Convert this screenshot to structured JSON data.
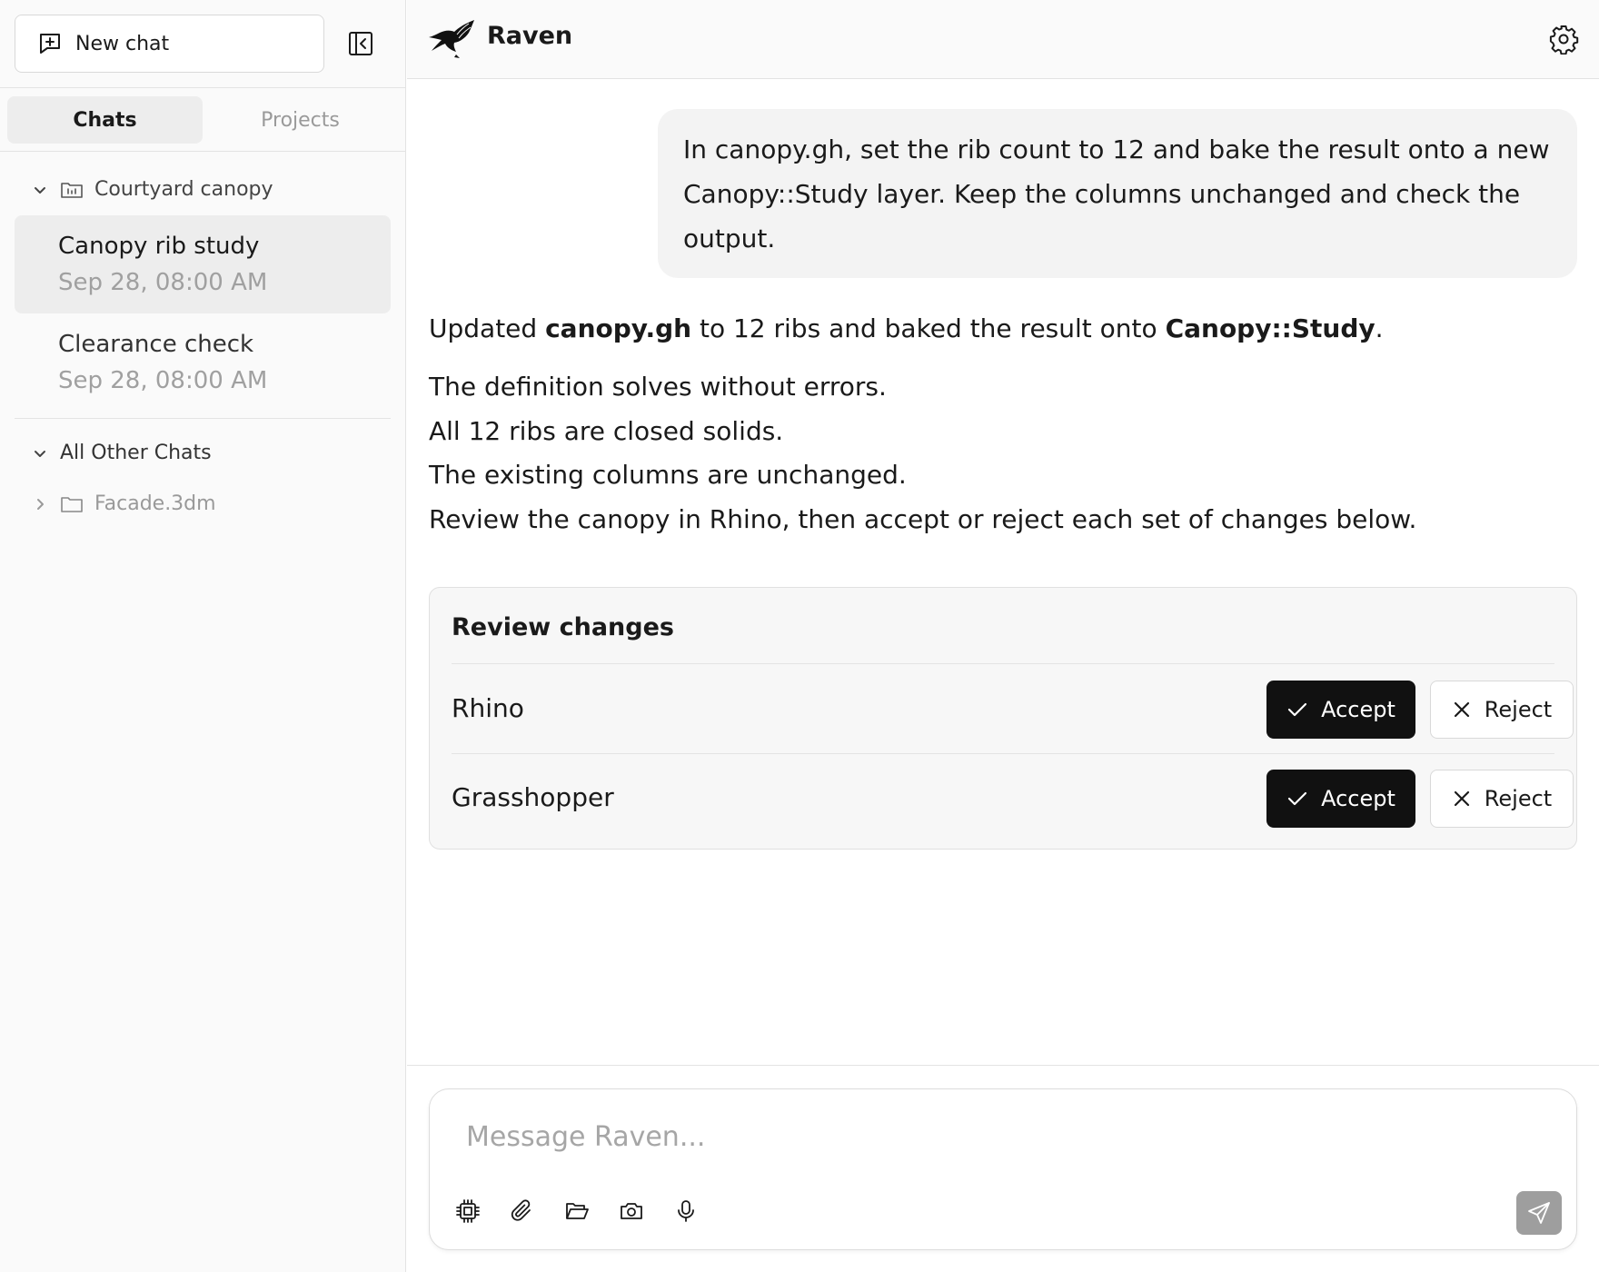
{
  "sidebar": {
    "new_chat_label": "New chat",
    "tabs": [
      {
        "label": "Chats",
        "active": true
      },
      {
        "label": "Projects",
        "active": false
      }
    ],
    "project_group": {
      "name": "Courtyard canopy",
      "chats": [
        {
          "title": "Canopy rib study",
          "date": "Sep 28, 08:00 AM",
          "active": true
        },
        {
          "title": "Clearance check",
          "date": "Sep 28, 08:00 AM",
          "active": false
        }
      ]
    },
    "other_chats_label": "All Other Chats",
    "folders": [
      {
        "name": "Facade.3dm"
      }
    ]
  },
  "header": {
    "app_name": "Raven"
  },
  "conversation": {
    "user_message": "In canopy.gh, set the rib count to 12 and bake the result onto a new Canopy::Study layer. Keep the columns unchanged and check the output.",
    "reply": {
      "summary_parts": [
        "Updated ",
        "canopy.gh",
        " to 12 ribs and baked the result onto ",
        "Canopy::Study",
        "."
      ],
      "lines": [
        "The definition solves without errors.",
        "All 12 ribs are closed solids.",
        "The existing columns are unchanged.",
        "Review the canopy in Rhino, then accept or reject each set of changes below."
      ]
    },
    "review": {
      "title": "Review changes",
      "rows": [
        {
          "label": "Rhino",
          "accept_label": "Accept",
          "reject_label": "Reject"
        },
        {
          "label": "Grasshopper",
          "accept_label": "Accept",
          "reject_label": "Reject"
        }
      ]
    }
  },
  "composer": {
    "placeholder": "Message Raven...",
    "value": "",
    "tools": [
      "chip-icon",
      "paperclip-icon",
      "folder-open-icon",
      "camera-icon",
      "microphone-icon"
    ]
  },
  "colors": {
    "accent_dark": "#111111",
    "send_disabled": "#9e9e9e",
    "muted_text": "#a0a0a0"
  }
}
